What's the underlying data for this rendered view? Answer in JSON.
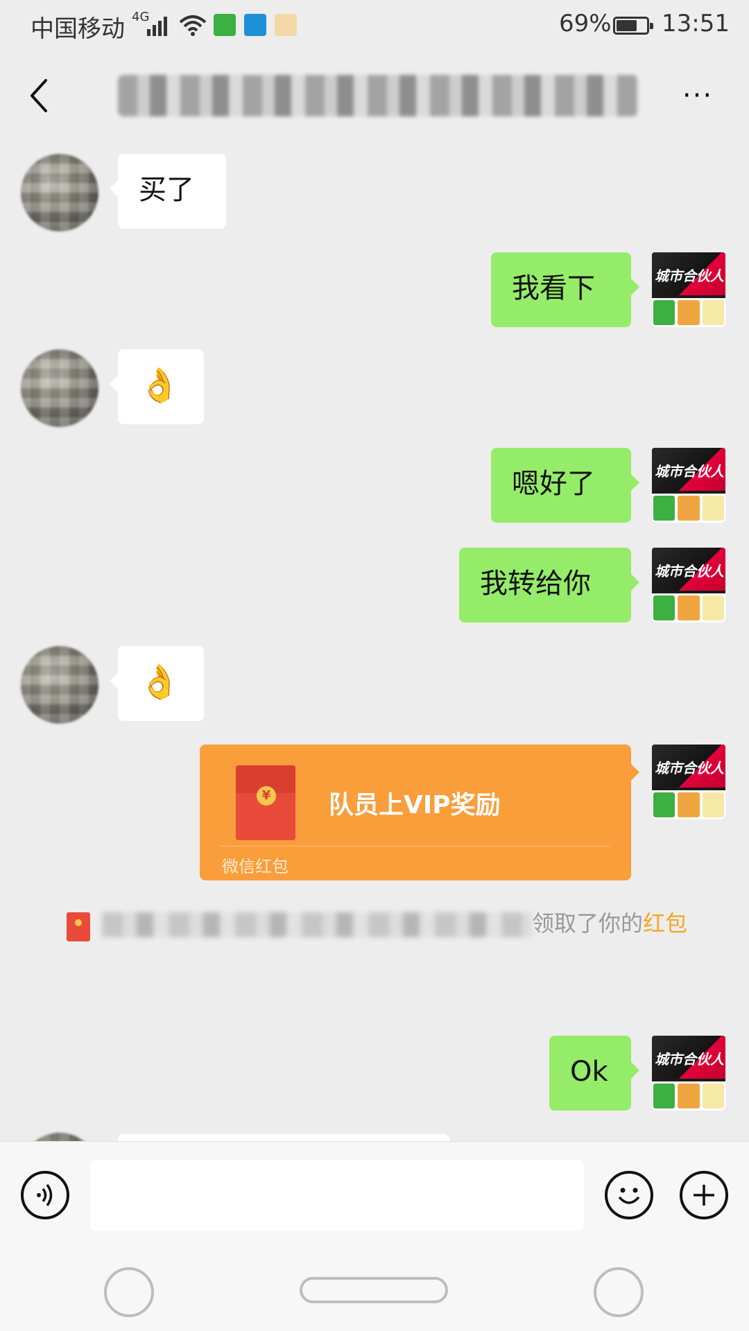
{
  "status_bar": {
    "carrier": "中国移动",
    "network": "4G",
    "battery": "69%",
    "time": "13:51"
  },
  "header": {
    "more": "···"
  },
  "messages": [
    {
      "side": "in",
      "text": "买了"
    },
    {
      "side": "out",
      "text": "我看下"
    },
    {
      "side": "in",
      "text": "👌"
    },
    {
      "side": "out",
      "text": "嗯好了"
    },
    {
      "side": "out",
      "text": "我转给你"
    },
    {
      "side": "in",
      "text": "👌"
    }
  ],
  "red_packet": {
    "title": "队员上VIP奖励",
    "label": "微信红包"
  },
  "system_message": {
    "text": "领取了你的",
    "link": "红包"
  },
  "last_message": {
    "side": "out",
    "text": "Ok"
  },
  "self_avatar": {
    "brand": "城市合伙人"
  },
  "input": {
    "placeholder": ""
  }
}
